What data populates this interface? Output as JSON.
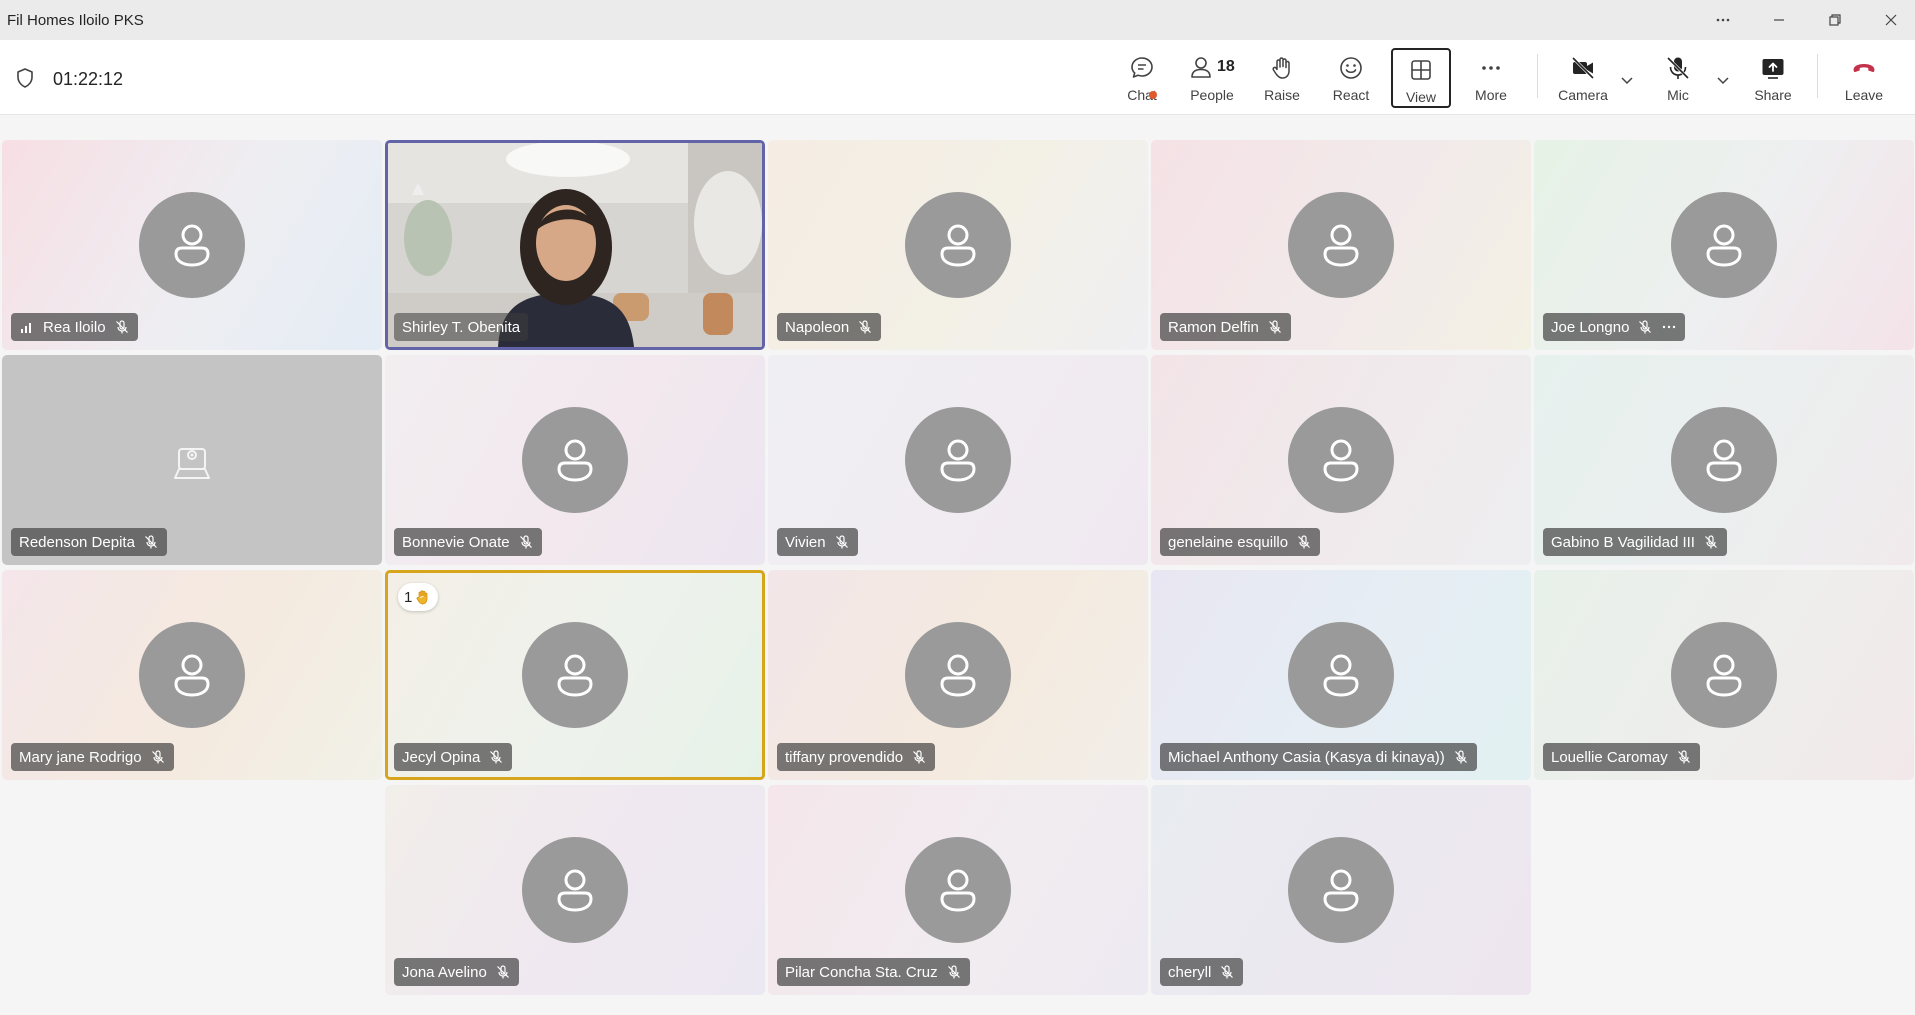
{
  "window": {
    "title": "Fil Homes Iloilo PKS"
  },
  "meeting": {
    "timer": "01:22:12"
  },
  "toolbar": {
    "chat_label": "Chat",
    "people_label": "People",
    "people_count": "18",
    "raise_label": "Raise",
    "react_label": "React",
    "view_label": "View",
    "more_label": "More",
    "camera_label": "Camera",
    "mic_label": "Mic",
    "share_label": "Share",
    "leave_label": "Leave",
    "leave_color": "#c4314b",
    "active_border": "#242424"
  },
  "participants": [
    {
      "name": "Rea Iloilo"
    },
    {
      "name": "Shirley T. Obenita"
    },
    {
      "name": "Napoleon"
    },
    {
      "name": "Ramon Delfin"
    },
    {
      "name": "Joe Longno"
    },
    {
      "name": "Redenson Depita"
    },
    {
      "name": "Bonnevie Onate"
    },
    {
      "name": "Vivien"
    },
    {
      "name": "genelaine esquillo"
    },
    {
      "name": "Gabino B Vagilidad III"
    },
    {
      "name": "Mary jane Rodrigo"
    },
    {
      "name": "Jecyl Opina"
    },
    {
      "name": "tiffany provendido"
    },
    {
      "name": "Michael Anthony Casia (Kasya di kinaya))"
    },
    {
      "name": "Louellie Caromay"
    },
    {
      "name": "Jona Avelino"
    },
    {
      "name": "Pilar Concha Sta. Cruz"
    },
    {
      "name": "cheryll"
    }
  ],
  "raised_hand": {
    "order": "1"
  },
  "colors": {
    "speaking_border": "#6264a7",
    "raised_border": "#d6a51b",
    "avatar_bg": "#9a9a9a"
  }
}
